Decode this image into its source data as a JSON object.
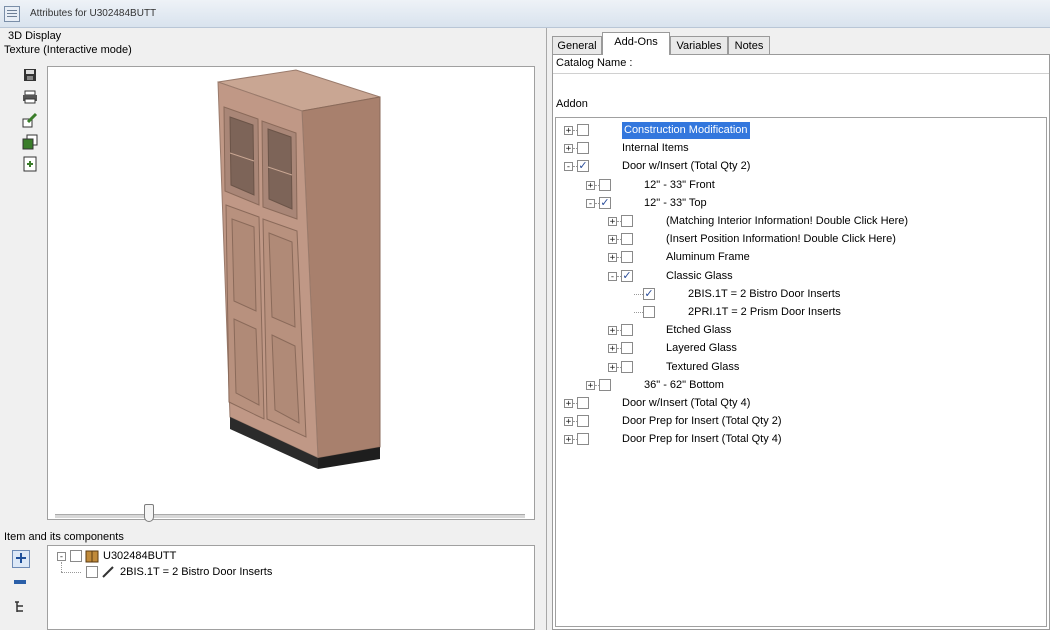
{
  "window": {
    "title": "Attributes for U302484BUTT"
  },
  "left": {
    "display_label": "3D Display",
    "texture_label": "Texture (Interactive mode)",
    "toolbar": [
      "save-icon",
      "print-icon",
      "edit-icon",
      "copy-icon",
      "export-icon"
    ],
    "slider_level": 0.2,
    "components_label": "Item and its components",
    "components": {
      "root": "U302484BUTT",
      "child": "2BIS.1T = 2 Bistro Door Inserts"
    }
  },
  "right": {
    "tabs": [
      "General",
      "Add-Ons",
      "Variables",
      "Notes"
    ],
    "active_tab": "Add-Ons",
    "catalog_label": "Catalog Name :",
    "addon_label": "Addon",
    "tree": [
      {
        "label": "Construction Modification",
        "level": 0,
        "checked": false,
        "expander": "+",
        "selected": true
      },
      {
        "label": "Internal Items",
        "level": 0,
        "checked": false,
        "expander": "+"
      },
      {
        "label": "Door w/Insert (Total Qty 2)",
        "level": 0,
        "checked": true,
        "expander": "-"
      },
      {
        "label": "12\" - 33\" Front",
        "level": 1,
        "checked": false,
        "expander": "+"
      },
      {
        "label": "12\" - 33\" Top",
        "level": 1,
        "checked": true,
        "expander": "-"
      },
      {
        "label": "(Matching Interior Information! Double Click Here)",
        "level": 2,
        "checked": false,
        "expander": "+"
      },
      {
        "label": "(Insert Position Information! Double Click Here)",
        "level": 2,
        "checked": false,
        "expander": "+"
      },
      {
        "label": "Aluminum Frame",
        "level": 2,
        "checked": false,
        "expander": "+"
      },
      {
        "label": "Classic Glass",
        "level": 2,
        "checked": true,
        "expander": "-"
      },
      {
        "label": "2BIS.1T = 2 Bistro Door Inserts",
        "level": 3,
        "checked": true,
        "expander": ""
      },
      {
        "label": "2PRI.1T = 2 Prism Door Inserts",
        "level": 3,
        "checked": false,
        "expander": ""
      },
      {
        "label": "Etched Glass",
        "level": 2,
        "checked": false,
        "expander": "+"
      },
      {
        "label": "Layered Glass",
        "level": 2,
        "checked": false,
        "expander": "+"
      },
      {
        "label": "Textured Glass",
        "level": 2,
        "checked": false,
        "expander": "+"
      },
      {
        "label": "36\" - 62\" Bottom",
        "level": 1,
        "checked": false,
        "expander": "+"
      },
      {
        "label": "Door w/Insert (Total Qty 4)",
        "level": 0,
        "checked": false,
        "expander": "+"
      },
      {
        "label": "Door Prep for Insert (Total Qty 2)",
        "level": 0,
        "checked": false,
        "expander": "+"
      },
      {
        "label": "Door Prep for Insert (Total Qty 4)",
        "level": 0,
        "checked": false,
        "expander": "+"
      }
    ]
  },
  "colors": {
    "selection": "#3377dd",
    "cabinet": "#b8917e",
    "check": "#2a4d9a"
  }
}
